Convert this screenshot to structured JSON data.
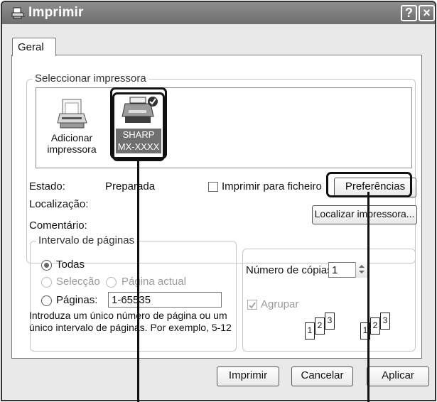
{
  "window": {
    "title": "Imprimir",
    "help_icon": "help-icon",
    "close_icon": "close-icon"
  },
  "tabs": [
    {
      "label": "Geral"
    }
  ],
  "select_printer": {
    "title": "Seleccionar impressora",
    "items": [
      {
        "label_line1": "Adicionar",
        "label_line2": "impressora",
        "icon": "add-printer-icon"
      },
      {
        "label_line1": "SHARP",
        "label_line2": "MX-XXXX",
        "icon": "printer-icon"
      }
    ]
  },
  "status": {
    "state_label": "Estado:",
    "state_value": "Preparada",
    "location_label": "Localização:",
    "comment_label": "Comentário:"
  },
  "print_to_file": {
    "label": "Imprimir para ficheiro"
  },
  "buttons": {
    "preferences": "Preferências",
    "find_printer": "Localizar impressora..."
  },
  "page_range": {
    "title": "Intervalo de páginas",
    "all": "Todas",
    "selection": "Selecção",
    "current_page": "Página actual",
    "pages": "Páginas:",
    "pages_value": "1-65535",
    "help_line1": "Introduza um único número de página ou um",
    "help_line2": "único intervalo de páginas. Por exemplo, 5-12"
  },
  "copies": {
    "label": "Número de cópias:",
    "value": "1",
    "collate": "Agrupar",
    "collate_icons": [
      "1",
      "2",
      "3",
      "1",
      "2",
      "3"
    ]
  },
  "footer": {
    "print": "Imprimir",
    "cancel": "Cancelar",
    "apply": "Aplicar"
  }
}
